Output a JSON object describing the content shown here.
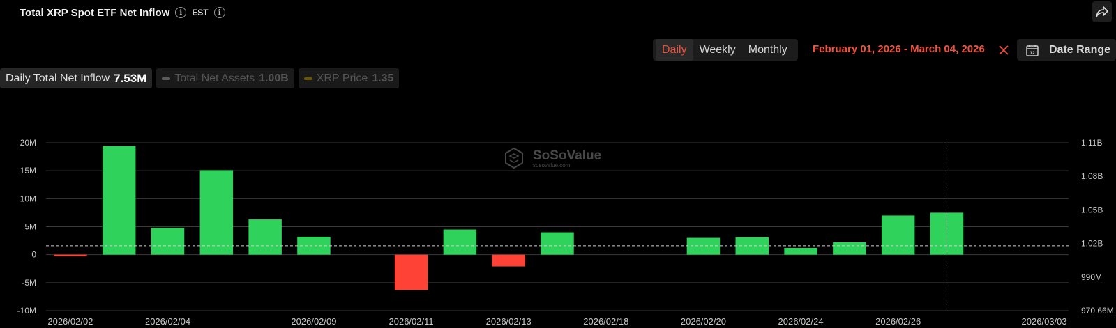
{
  "header": {
    "title": "Total XRP Spot ETF Net Inflow",
    "timezone": "EST"
  },
  "controls": {
    "periods": [
      "Daily",
      "Weekly",
      "Monthly"
    ],
    "active_period": "Daily",
    "date_range_text": "February 01, 2026 - March 04, 2026",
    "date_range_button": "Date Range"
  },
  "legend": [
    {
      "label": "Daily Total Net Inflow",
      "value": "7.53M",
      "active": true
    },
    {
      "label": "Total Net Assets",
      "value": "1.00B",
      "active": false
    },
    {
      "label": "XRP Price",
      "value": "1.35",
      "active": false
    }
  ],
  "watermark": {
    "name": "SoSoValue",
    "site": "sosovalue.com"
  },
  "colors": {
    "positive": "#2fd25b",
    "negative": "#ff4236",
    "accent": "#f0503b",
    "assets_line": "#8a8a8a",
    "price_line": "#8a6d00"
  },
  "chart_data": {
    "type": "bar",
    "title": "Total XRP Spot ETF Net Inflow",
    "categories": [
      "2026/02/02",
      "2026/02/03",
      "2026/02/04",
      "2026/02/05",
      "2026/02/06",
      "2026/02/09",
      "2026/02/10",
      "2026/02/11",
      "2026/02/12",
      "2026/02/13",
      "2026/02/17",
      "2026/02/18",
      "2026/02/19",
      "2026/02/20",
      "2026/02/23",
      "2026/02/24",
      "2026/02/25",
      "2026/02/26",
      "2026/02/27",
      "2026/03/02",
      "2026/03/03"
    ],
    "x_tick_labels": [
      "2026/02/02",
      "2026/02/04",
      "2026/02/09",
      "2026/02/11",
      "2026/02/13",
      "2026/02/18",
      "2026/02/20",
      "2026/02/24",
      "2026/02/26",
      "2026/03/03"
    ],
    "series": [
      {
        "name": "Daily Total Net Inflow",
        "values": [
          -0.3,
          19.4,
          4.8,
          15.1,
          6.3,
          3.2,
          0,
          -6.3,
          4.5,
          -2.1,
          4.0,
          0,
          0,
          3.0,
          3.1,
          1.2,
          2.2,
          7.0,
          7.5,
          0,
          0
        ]
      }
    ],
    "values_M_by_date": {
      "2026/02/02": -0.3,
      "2026/02/03": 19.4,
      "2026/02/04": 4.8,
      "2026/02/05": 15.1,
      "2026/02/06": 6.3,
      "2026/02/09": 3.2,
      "2026/02/10": 0,
      "2026/02/11": -6.3,
      "2026/02/12": 4.5,
      "2026/02/13": -2.1,
      "2026/02/17": 4.0
    },
    "left_axis": {
      "ticks": [
        "20M",
        "15M",
        "10M",
        "5M",
        "0",
        "-5M",
        "-10M"
      ],
      "ylim": [
        -10,
        20
      ],
      "unit": "M"
    },
    "right_axis": {
      "ticks": [
        "1.11B",
        "1.08B",
        "1.05B",
        "1.02B",
        "990M",
        "970.66M"
      ]
    },
    "grid": true,
    "reference_line_value": 1.6
  }
}
